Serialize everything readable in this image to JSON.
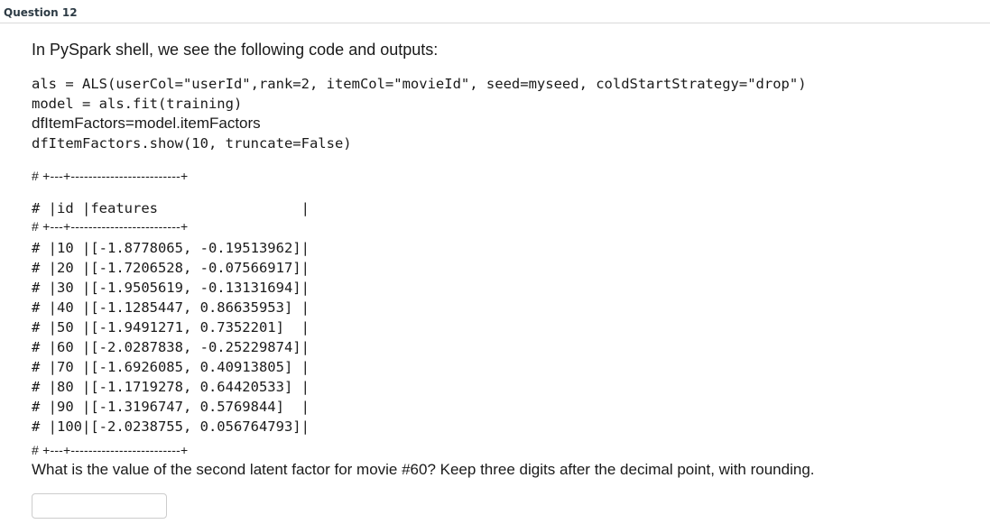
{
  "header": {
    "title": "Question 12"
  },
  "prompt": "In PySpark shell, we see the following code and outputs:",
  "code_lines": [
    "als = ALS(userCol=\"userId\",rank=2, itemCol=\"movieId\", seed=myseed, coldStartStrategy=\"drop\")",
    "model = als.fit(training)",
    "dfItemFactors=model.itemFactors",
    "dfItemFactors.show(10, truncate=False)"
  ],
  "output": {
    "separator": "# +---+-------------------------+",
    "header_row": "# |id |features                 |",
    "rows": [
      "# |10 |[-1.8778065, -0.19513962]|",
      "# |20 |[-1.7206528, -0.07566917]|",
      "# |30 |[-1.9505619, -0.13131694]|",
      "# |40 |[-1.1285447, 0.86635953] |",
      "# |50 |[-1.9491271, 0.7352201]  |",
      "# |60 |[-2.0287838, -0.25229874]|",
      "# |70 |[-1.6926085, 0.40913805] |",
      "# |80 |[-1.1719278, 0.64420533] |",
      "# |90 |[-1.3196747, 0.5769844]  |",
      "# |100|[-2.0238755, 0.056764793]|"
    ]
  },
  "question": "What is the value of the second latent factor for movie #60? Keep three digits after the decimal point, with rounding.",
  "answer": {
    "value": ""
  }
}
